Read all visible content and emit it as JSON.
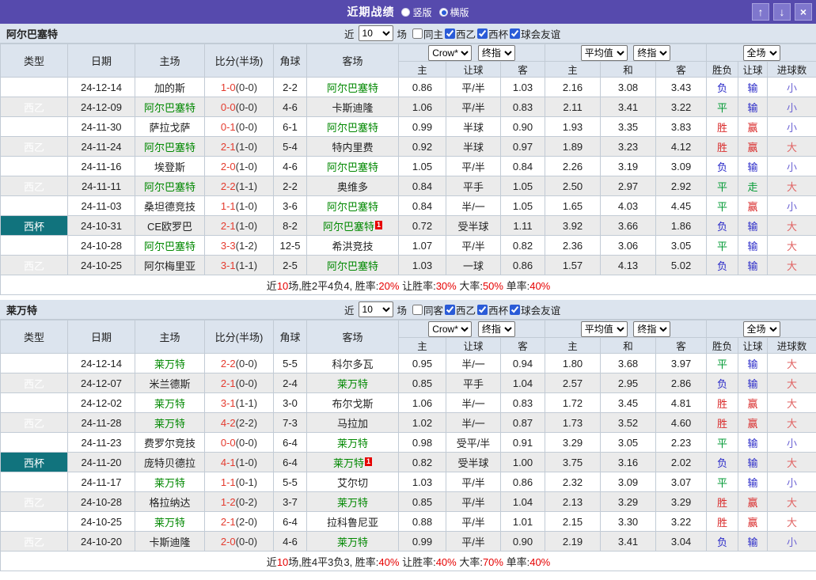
{
  "titlebar": {
    "title": "近期战绩",
    "modes": [
      {
        "label": "竖版",
        "selected": false
      },
      {
        "label": "横版",
        "selected": true
      }
    ],
    "buttons": {
      "up": "↑",
      "down": "↓",
      "close": "×"
    }
  },
  "colors": {
    "purple": "#564aad",
    "btn-purple": "#7f77cd",
    "btn-border": "#a9a3e0",
    "header-bg": "#dce4ee",
    "border": "#c2cbd5",
    "row-alt": "#ebebeb",
    "league-green": "#5aa315",
    "cup-teal": "#11737d",
    "focus-green": "#008800",
    "score-red": "#e43b2e",
    "win-red": "#d92b2b",
    "draw-green": "#009933",
    "loss-blue": "#2a2ac8",
    "big-red": "#e06262",
    "small-blue": "#6c63d4",
    "crow-bg": "#fdf8f0",
    "crow-bg-alt": "#f0ebe3",
    "avg-bg": "#e9f3fb",
    "avg-bg-alt": "#e2eaf1",
    "summary-red": "#e60000"
  },
  "columns": {
    "type": "类型",
    "date": "日期",
    "home": "主场",
    "score": "比分(半场)",
    "corner": "角球",
    "away": "客场",
    "sub_home": "主",
    "sub_handicap": "让球",
    "sub_away": "客",
    "avg_home": "主",
    "avg_draw": "和",
    "avg_away": "客",
    "wdl": "胜负",
    "handicap": "让球",
    "goals": "进球数"
  },
  "dropdowns": {
    "crow": "Crow*",
    "final": "终指",
    "avg": "平均值",
    "scope": "全场"
  },
  "sections": [
    {
      "team": "阿尔巴塞特",
      "filter": {
        "near": "近",
        "games": "场",
        "count": "10",
        "same_label": "同主",
        "same_checked": false,
        "leagues": [
          {
            "label": "西乙",
            "checked": true
          },
          {
            "label": "西杯",
            "checked": true
          },
          {
            "label": "球会友谊",
            "checked": true
          }
        ]
      },
      "rows": [
        {
          "lg": "西乙",
          "date": "24-12-14",
          "home": "加的斯",
          "score": "1-0",
          "half": "(0-0)",
          "corner": "2-2",
          "away": "阿尔巴塞特",
          "af": true,
          "crow": [
            "0.86",
            "平/半",
            "1.03"
          ],
          "avg": [
            "2.16",
            "3.08",
            "3.43"
          ],
          "res": [
            [
              "负",
              "b"
            ],
            [
              "输",
              "b"
            ],
            [
              "小",
              "B"
            ]
          ]
        },
        {
          "lg": "西乙",
          "date": "24-12-09",
          "home": "阿尔巴塞特",
          "hf": true,
          "score": "0-0",
          "half": "(0-0)",
          "corner": "4-6",
          "away": "卡斯迪隆",
          "crow": [
            "1.06",
            "平/半",
            "0.83"
          ],
          "avg": [
            "2.11",
            "3.41",
            "3.22"
          ],
          "res": [
            [
              "平",
              "g"
            ],
            [
              "输",
              "b"
            ],
            [
              "小",
              "B"
            ]
          ]
        },
        {
          "lg": "西乙",
          "date": "24-11-30",
          "home": "萨拉戈萨",
          "score": "0-1",
          "half": "(0-0)",
          "corner": "6-1",
          "away": "阿尔巴塞特",
          "af": true,
          "crow": [
            "0.99",
            "半球",
            "0.90"
          ],
          "avg": [
            "1.93",
            "3.35",
            "3.83"
          ],
          "res": [
            [
              "胜",
              "r"
            ],
            [
              "赢",
              "r"
            ],
            [
              "小",
              "B"
            ]
          ]
        },
        {
          "lg": "西乙",
          "date": "24-11-24",
          "home": "阿尔巴塞特",
          "hf": true,
          "score": "2-1",
          "half": "(1-0)",
          "corner": "5-4",
          "away": "特内里费",
          "crow": [
            "0.92",
            "半球",
            "0.97"
          ],
          "avg": [
            "1.89",
            "3.23",
            "4.12"
          ],
          "res": [
            [
              "胜",
              "r"
            ],
            [
              "赢",
              "r"
            ],
            [
              "大",
              "R"
            ]
          ]
        },
        {
          "lg": "西乙",
          "date": "24-11-16",
          "home": "埃登斯",
          "score": "2-0",
          "half": "(1-0)",
          "corner": "4-6",
          "away": "阿尔巴塞特",
          "af": true,
          "crow": [
            "1.05",
            "平/半",
            "0.84"
          ],
          "avg": [
            "2.26",
            "3.19",
            "3.09"
          ],
          "res": [
            [
              "负",
              "b"
            ],
            [
              "输",
              "b"
            ],
            [
              "小",
              "B"
            ]
          ]
        },
        {
          "lg": "西乙",
          "date": "24-11-11",
          "home": "阿尔巴塞特",
          "hf": true,
          "score": "2-2",
          "half": "(1-1)",
          "corner": "2-2",
          "away": "奥维多",
          "crow": [
            "0.84",
            "平手",
            "1.05"
          ],
          "avg": [
            "2.50",
            "2.97",
            "2.92"
          ],
          "res": [
            [
              "平",
              "g"
            ],
            [
              "走",
              "g"
            ],
            [
              "大",
              "R"
            ]
          ]
        },
        {
          "lg": "西乙",
          "date": "24-11-03",
          "home": "桑坦德竞技",
          "score": "1-1",
          "half": "(1-0)",
          "corner": "3-6",
          "away": "阿尔巴塞特",
          "af": true,
          "crow": [
            "0.84",
            "半/一",
            "1.05"
          ],
          "avg": [
            "1.65",
            "4.03",
            "4.45"
          ],
          "res": [
            [
              "平",
              "g"
            ],
            [
              "赢",
              "r"
            ],
            [
              "小",
              "B"
            ]
          ]
        },
        {
          "lg": "西杯",
          "cup": true,
          "date": "24-10-31",
          "home": "CE欧罗巴",
          "score": "2-1",
          "half": "(1-0)",
          "corner": "8-2",
          "away": "阿尔巴塞特",
          "af": true,
          "ab": "1",
          "crow": [
            "0.72",
            "受半球",
            "1.11"
          ],
          "avg": [
            "3.92",
            "3.66",
            "1.86"
          ],
          "res": [
            [
              "负",
              "b"
            ],
            [
              "输",
              "b"
            ],
            [
              "大",
              "R"
            ]
          ]
        },
        {
          "lg": "西乙",
          "date": "24-10-28",
          "home": "阿尔巴塞特",
          "hf": true,
          "score": "3-3",
          "half": "(1-2)",
          "corner": "12-5",
          "away": "希洪竞技",
          "crow": [
            "1.07",
            "平/半",
            "0.82"
          ],
          "avg": [
            "2.36",
            "3.06",
            "3.05"
          ],
          "res": [
            [
              "平",
              "g"
            ],
            [
              "输",
              "b"
            ],
            [
              "大",
              "R"
            ]
          ]
        },
        {
          "lg": "西乙",
          "date": "24-10-25",
          "home": "阿尔梅里亚",
          "score": "3-1",
          "half": "(1-1)",
          "corner": "2-5",
          "away": "阿尔巴塞特",
          "af": true,
          "crow": [
            "1.03",
            "一球",
            "0.86"
          ],
          "avg": [
            "1.57",
            "4.13",
            "5.02"
          ],
          "res": [
            [
              "负",
              "b"
            ],
            [
              "输",
              "b"
            ],
            [
              "大",
              "R"
            ]
          ]
        }
      ],
      "summary": [
        {
          "t": "近"
        },
        {
          "t": "10",
          "c": "r"
        },
        {
          "t": "场,胜2平4负4, 胜率:"
        },
        {
          "t": "20%",
          "c": "r"
        },
        {
          "t": " 让胜率:"
        },
        {
          "t": "30%",
          "c": "r"
        },
        {
          "t": " 大率:"
        },
        {
          "t": "50%",
          "c": "r"
        },
        {
          "t": " 单率:"
        },
        {
          "t": "40%",
          "c": "r"
        }
      ]
    },
    {
      "team": "莱万特",
      "filter": {
        "near": "近",
        "games": "场",
        "count": "10",
        "same_label": "同客",
        "same_checked": false,
        "leagues": [
          {
            "label": "西乙",
            "checked": true
          },
          {
            "label": "西杯",
            "checked": true
          },
          {
            "label": "球会友谊",
            "checked": true
          }
        ]
      },
      "rows": [
        {
          "lg": "西乙",
          "date": "24-12-14",
          "home": "莱万特",
          "hf": true,
          "score": "2-2",
          "half": "(0-0)",
          "corner": "5-5",
          "away": "科尔多瓦",
          "crow": [
            "0.95",
            "半/一",
            "0.94"
          ],
          "avg": [
            "1.80",
            "3.68",
            "3.97"
          ],
          "res": [
            [
              "平",
              "g"
            ],
            [
              "输",
              "b"
            ],
            [
              "大",
              "R"
            ]
          ]
        },
        {
          "lg": "西乙",
          "date": "24-12-07",
          "home": "米兰德斯",
          "score": "2-1",
          "half": "(0-0)",
          "corner": "2-4",
          "away": "莱万特",
          "af": true,
          "crow": [
            "0.85",
            "平手",
            "1.04"
          ],
          "avg": [
            "2.57",
            "2.95",
            "2.86"
          ],
          "res": [
            [
              "负",
              "b"
            ],
            [
              "输",
              "b"
            ],
            [
              "大",
              "R"
            ]
          ]
        },
        {
          "lg": "西乙",
          "date": "24-12-02",
          "home": "莱万特",
          "hf": true,
          "score": "3-1",
          "half": "(1-1)",
          "corner": "3-0",
          "away": "布尔戈斯",
          "crow": [
            "1.06",
            "半/一",
            "0.83"
          ],
          "avg": [
            "1.72",
            "3.45",
            "4.81"
          ],
          "res": [
            [
              "胜",
              "r"
            ],
            [
              "赢",
              "r"
            ],
            [
              "大",
              "R"
            ]
          ]
        },
        {
          "lg": "西乙",
          "date": "24-11-28",
          "home": "莱万特",
          "hf": true,
          "score": "4-2",
          "half": "(2-2)",
          "corner": "7-3",
          "away": "马拉加",
          "crow": [
            "1.02",
            "半/一",
            "0.87"
          ],
          "avg": [
            "1.73",
            "3.52",
            "4.60"
          ],
          "res": [
            [
              "胜",
              "r"
            ],
            [
              "赢",
              "r"
            ],
            [
              "大",
              "R"
            ]
          ]
        },
        {
          "lg": "西乙",
          "date": "24-11-23",
          "home": "费罗尔竞技",
          "score": "0-0",
          "half": "(0-0)",
          "corner": "6-4",
          "away": "莱万特",
          "af": true,
          "crow": [
            "0.98",
            "受平/半",
            "0.91"
          ],
          "avg": [
            "3.29",
            "3.05",
            "2.23"
          ],
          "res": [
            [
              "平",
              "g"
            ],
            [
              "输",
              "b"
            ],
            [
              "小",
              "B"
            ]
          ]
        },
        {
          "lg": "西杯",
          "cup": true,
          "date": "24-11-20",
          "home": "庞特贝德拉",
          "score": "4-1",
          "half": "(1-0)",
          "corner": "6-4",
          "away": "莱万特",
          "af": true,
          "ab": "1",
          "crow": [
            "0.82",
            "受半球",
            "1.00"
          ],
          "avg": [
            "3.75",
            "3.16",
            "2.02"
          ],
          "res": [
            [
              "负",
              "b"
            ],
            [
              "输",
              "b"
            ],
            [
              "大",
              "R"
            ]
          ]
        },
        {
          "lg": "西乙",
          "date": "24-11-17",
          "home": "莱万特",
          "hf": true,
          "score": "1-1",
          "half": "(0-1)",
          "corner": "5-5",
          "away": "艾尔切",
          "crow": [
            "1.03",
            "平/半",
            "0.86"
          ],
          "avg": [
            "2.32",
            "3.09",
            "3.07"
          ],
          "res": [
            [
              "平",
              "g"
            ],
            [
              "输",
              "b"
            ],
            [
              "小",
              "B"
            ]
          ]
        },
        {
          "lg": "西乙",
          "date": "24-10-28",
          "home": "格拉纳达",
          "score": "1-2",
          "half": "(0-2)",
          "corner": "3-7",
          "away": "莱万特",
          "af": true,
          "crow": [
            "0.85",
            "平/半",
            "1.04"
          ],
          "avg": [
            "2.13",
            "3.29",
            "3.29"
          ],
          "res": [
            [
              "胜",
              "r"
            ],
            [
              "赢",
              "r"
            ],
            [
              "大",
              "R"
            ]
          ]
        },
        {
          "lg": "西乙",
          "date": "24-10-25",
          "home": "莱万特",
          "hf": true,
          "score": "2-1",
          "half": "(2-0)",
          "corner": "6-4",
          "away": "拉科鲁尼亚",
          "crow": [
            "0.88",
            "平/半",
            "1.01"
          ],
          "avg": [
            "2.15",
            "3.30",
            "3.22"
          ],
          "res": [
            [
              "胜",
              "r"
            ],
            [
              "赢",
              "r"
            ],
            [
              "大",
              "R"
            ]
          ]
        },
        {
          "lg": "西乙",
          "date": "24-10-20",
          "home": "卡斯迪隆",
          "score": "2-0",
          "half": "(0-0)",
          "corner": "4-6",
          "away": "莱万特",
          "af": true,
          "crow": [
            "0.99",
            "平/半",
            "0.90"
          ],
          "avg": [
            "2.19",
            "3.41",
            "3.04"
          ],
          "res": [
            [
              "负",
              "b"
            ],
            [
              "输",
              "b"
            ],
            [
              "小",
              "B"
            ]
          ]
        }
      ],
      "summary": [
        {
          "t": "近"
        },
        {
          "t": "10",
          "c": "r"
        },
        {
          "t": "场,胜4平3负3, 胜率:"
        },
        {
          "t": "40%",
          "c": "r"
        },
        {
          "t": " 让胜率:"
        },
        {
          "t": "40%",
          "c": "r"
        },
        {
          "t": " 大率:"
        },
        {
          "t": "70%",
          "c": "r"
        },
        {
          "t": " 单率:"
        },
        {
          "t": "40%",
          "c": "r"
        }
      ]
    }
  ]
}
